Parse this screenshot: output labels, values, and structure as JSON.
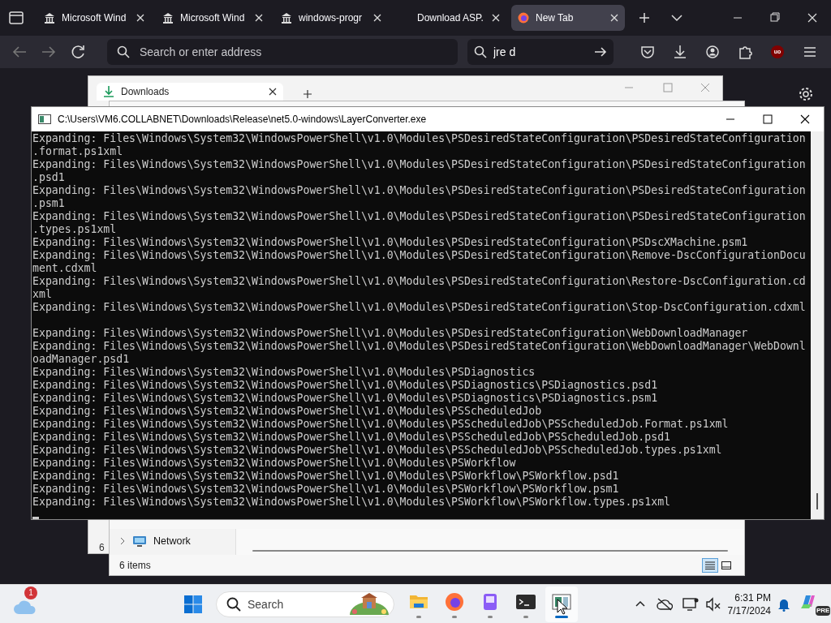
{
  "browser": {
    "tabs": [
      {
        "label": "Microsoft Wind",
        "kind": "pillar",
        "selected": false
      },
      {
        "label": "Microsoft Wind",
        "kind": "pillar",
        "selected": false
      },
      {
        "label": "windows-progr",
        "kind": "pillar",
        "selected": false
      },
      {
        "label": "Download ASP.",
        "kind": "plain",
        "selected": false
      },
      {
        "label": "New Tab",
        "kind": "firefox",
        "selected": true
      }
    ],
    "address": {
      "placeholder": "Search or enter address"
    },
    "search": {
      "value": "jre d"
    },
    "extension_badge": "uo"
  },
  "explorer_back": {
    "tab_label": "Downloads",
    "item_count": "6"
  },
  "explorer_front": {
    "nav_items": [
      {
        "label": "Network",
        "expanded": false
      }
    ],
    "status": "6 items",
    "views": [
      {
        "kind": "details",
        "selected": true
      },
      {
        "kind": "tiles",
        "selected": false
      }
    ]
  },
  "console": {
    "title": "C:\\Users\\VM6.COLLABNET\\Downloads\\Release\\net5.0-windows\\LayerConverter.exe",
    "lines": [
      {
        "text": "Expanding: Files\\Windows\\System32\\WindowsPowerShell\\v1.0\\Modules\\PSDesiredStateConfiguration\\PSDesiredStateConfiguration"
      },
      {
        "text": ".format.ps1xml"
      },
      {
        "text": "Expanding: Files\\Windows\\System32\\WindowsPowerShell\\v1.0\\Modules\\PSDesiredStateConfiguration\\PSDesiredStateConfiguration"
      },
      {
        "text": ".psd1"
      },
      {
        "text": "Expanding: Files\\Windows\\System32\\WindowsPowerShell\\v1.0\\Modules\\PSDesiredStateConfiguration\\PSDesiredStateConfiguration"
      },
      {
        "text": ".psm1"
      },
      {
        "text": "Expanding: Files\\Windows\\System32\\WindowsPowerShell\\v1.0\\Modules\\PSDesiredStateConfiguration\\PSDesiredStateConfiguration"
      },
      {
        "text": ".types.ps1xml"
      },
      {
        "text": "Expanding: Files\\Windows\\System32\\WindowsPowerShell\\v1.0\\Modules\\PSDesiredStateConfiguration\\PSDscXMachine.psm1"
      },
      {
        "text": "Expanding: Files\\Windows\\System32\\WindowsPowerShell\\v1.0\\Modules\\PSDesiredStateConfiguration\\Remove-DscConfigurationDocu"
      },
      {
        "text": "ment.cdxml"
      },
      {
        "text": "Expanding: Files\\Windows\\System32\\WindowsPowerShell\\v1.0\\Modules\\PSDesiredStateConfiguration\\Restore-DscConfiguration.cd"
      },
      {
        "text": "xml"
      },
      {
        "text": "Expanding: Files\\Windows\\System32\\WindowsPowerShell\\v1.0\\Modules\\PSDesiredStateConfiguration\\Stop-DscConfiguration.cdxml"
      },
      {
        "text": "Expanding: Files\\Windows\\System32\\WindowsPowerShell\\v1.0\\Modules\\PSDesiredStateConfiguration\\WebDownloadManager",
        "gap_before": true
      },
      {
        "text": "Expanding: Files\\Windows\\System32\\WindowsPowerShell\\v1.0\\Modules\\PSDesiredStateConfiguration\\WebDownloadManager\\WebDownl"
      },
      {
        "text": "oadManager.psd1"
      },
      {
        "text": "Expanding: Files\\Windows\\System32\\WindowsPowerShell\\v1.0\\Modules\\PSDiagnostics"
      },
      {
        "text": "Expanding: Files\\Windows\\System32\\WindowsPowerShell\\v1.0\\Modules\\PSDiagnostics\\PSDiagnostics.psd1"
      },
      {
        "text": "Expanding: Files\\Windows\\System32\\WindowsPowerShell\\v1.0\\Modules\\PSDiagnostics\\PSDiagnostics.psm1"
      },
      {
        "text": "Expanding: Files\\Windows\\System32\\WindowsPowerShell\\v1.0\\Modules\\PSScheduledJob"
      },
      {
        "text": "Expanding: Files\\Windows\\System32\\WindowsPowerShell\\v1.0\\Modules\\PSScheduledJob\\PSScheduledJob.Format.ps1xml"
      },
      {
        "text": "Expanding: Files\\Windows\\System32\\WindowsPowerShell\\v1.0\\Modules\\PSScheduledJob\\PSScheduledJob.psd1"
      },
      {
        "text": "Expanding: Files\\Windows\\System32\\WindowsPowerShell\\v1.0\\Modules\\PSScheduledJob\\PSScheduledJob.types.ps1xml"
      },
      {
        "text": "Expanding: Files\\Windows\\System32\\WindowsPowerShell\\v1.0\\Modules\\PSWorkflow"
      },
      {
        "text": "Expanding: Files\\Windows\\System32\\WindowsPowerShell\\v1.0\\Modules\\PSWorkflow\\PSWorkflow.psd1"
      },
      {
        "text": "Expanding: Files\\Windows\\System32\\WindowsPowerShell\\v1.0\\Modules\\PSWorkflow\\PSWorkflow.psm1"
      },
      {
        "text": "Expanding: Files\\Windows\\System32\\WindowsPowerShell\\v1.0\\Modules\\PSWorkflow\\PSWorkflow.types.ps1xml"
      }
    ]
  },
  "taskbar": {
    "weather_badge": "1",
    "search": {
      "placeholder": "Search"
    },
    "apps": [
      {
        "kind": "folder",
        "active": false
      },
      {
        "kind": "firefox",
        "active": false
      },
      {
        "kind": "purple",
        "active": false
      },
      {
        "kind": "terminal",
        "active": false
      },
      {
        "kind": "converter",
        "active": true
      }
    ],
    "time": "6:31 PM",
    "date": "7/17/2024",
    "copilot_badge": "PRE"
  }
}
